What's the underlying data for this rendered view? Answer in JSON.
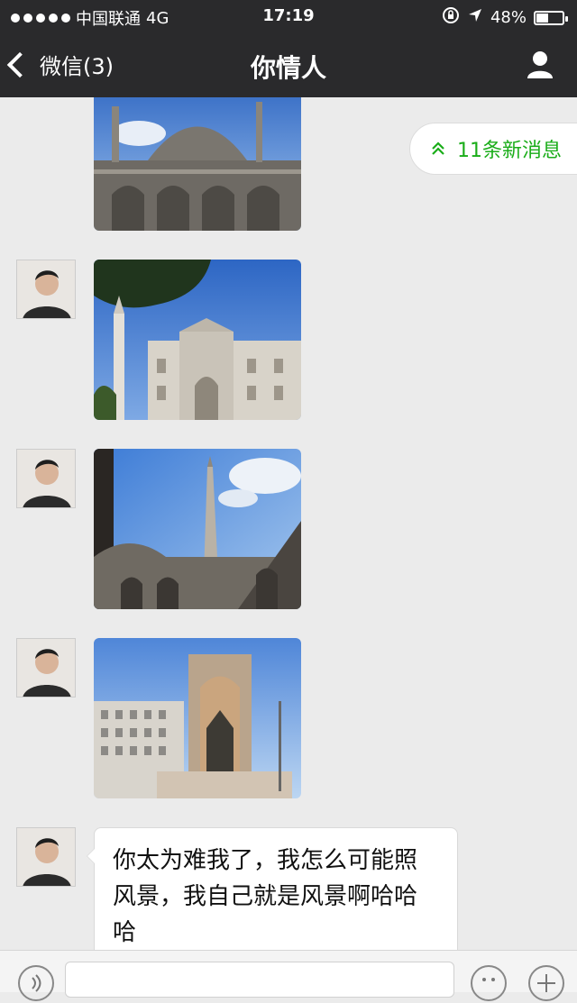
{
  "status_bar": {
    "carrier": "中国联通",
    "network": "4G",
    "time": "17:19",
    "battery": "48%",
    "battery_level": 0.48
  },
  "nav": {
    "back_label": "微信(3)",
    "title": "你情人"
  },
  "new_messages": {
    "label": "11条新消息"
  },
  "chat": {
    "message_text": "你太为难我了，我怎么可能照风景，我自己就是风景啊哈哈哈"
  },
  "colors": {
    "navbar": "#2a2a2c",
    "chat_bg": "#ebebeb",
    "accent_green": "#1aad19"
  },
  "icons": [
    "chevron-left-icon",
    "user-icon",
    "location-arrow-icon",
    "lock-rotation-icon",
    "voice-icon",
    "emoji-icon",
    "plus-icon"
  ]
}
